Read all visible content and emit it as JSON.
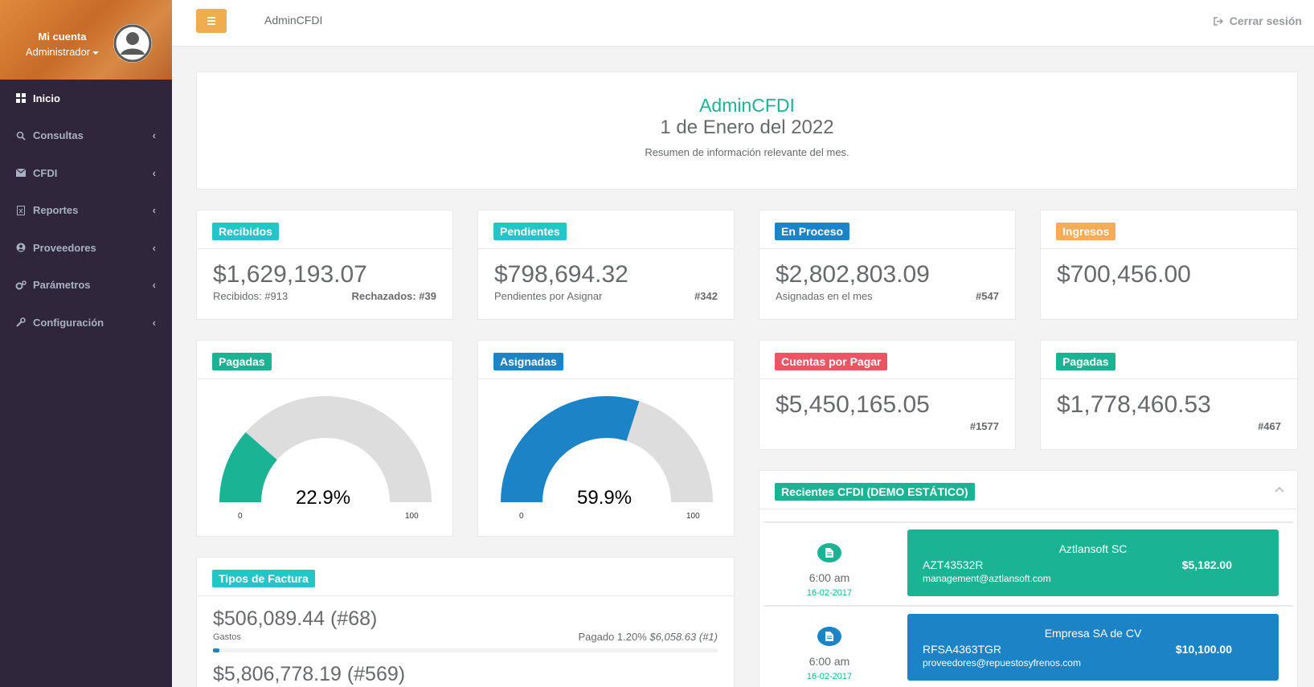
{
  "sidebar": {
    "account_name": "Mi cuenta",
    "account_role": "Administrador",
    "items": [
      {
        "label": "Inicio",
        "icon": "dashboard-icon"
      },
      {
        "label": "Consultas",
        "icon": "search-icon"
      },
      {
        "label": "CFDI",
        "icon": "envelope-icon"
      },
      {
        "label": "Reportes",
        "icon": "file-excel-icon"
      },
      {
        "label": "Proveedores",
        "icon": "user-circle-icon"
      },
      {
        "label": "Parámetros",
        "icon": "cogs-icon"
      },
      {
        "label": "Configuración",
        "icon": "wrench-icon"
      }
    ]
  },
  "topbar": {
    "brand": "AdminCFDI",
    "logout": "Cerrar sesión"
  },
  "header": {
    "title": "AdminCFDI",
    "date": "1 de Enero del 2022",
    "description": "Resumen de información relevante del mes."
  },
  "cards": {
    "recibidos": {
      "badge": "Recibidos",
      "amount": "$1,629,193.07",
      "left": "Recibidos: #913",
      "right": "Rechazados: #39"
    },
    "pendientes": {
      "badge": "Pendientes",
      "amount": "$798,694.32",
      "left": "Pendientes por Asignar",
      "right": "#342"
    },
    "en_proceso": {
      "badge": "En Proceso",
      "amount": "$2,802,803.09",
      "left": "Asignadas en el mes",
      "right": "#547"
    },
    "ingresos": {
      "badge": "Ingresos",
      "amount": "$700,456.00"
    },
    "cuentas_pagar": {
      "badge": "Cuentas por Pagar",
      "amount": "$5,450,165.05",
      "right": "#1577"
    },
    "pagadas_amount": {
      "badge": "Pagadas",
      "amount": "$1,778,460.53",
      "right": "#467"
    }
  },
  "gauges": {
    "pagadas": {
      "badge": "Pagadas",
      "percent_label": "22.9%",
      "value": 22.9,
      "min": "0",
      "max": "100",
      "color": "#1ab394"
    },
    "asignadas": {
      "badge": "Asignadas",
      "percent_label": "59.9%",
      "value": 59.9,
      "min": "0",
      "max": "100",
      "color": "#1c84c6"
    }
  },
  "tipos": {
    "badge": "Tipos de Factura",
    "rows": [
      {
        "amount": "$506,089.44 (#68)",
        "label": "Gastos",
        "paid_label": "Pagado 1.20%",
        "paid_value": "$6,058.63 (#1)",
        "progress": 1.2
      },
      {
        "amount": "$5,806,778.19 (#569)"
      }
    ]
  },
  "recientes": {
    "badge": "Recientes CFDI (DEMO ESTÁTICO)",
    "items": [
      {
        "time": "6:00 am",
        "date": "16-02-2017",
        "company": "Aztlansoft SC",
        "rfc": "AZT43532R",
        "amount": "$5,182.00",
        "email": "management@aztlansoft.com",
        "color": "#1ab394"
      },
      {
        "time": "6:00 am",
        "date": "16-02-2017",
        "company": "Empresa SA de CV",
        "rfc": "RFSA4363TGR",
        "amount": "$10,100.00",
        "email": "proveedores@repuestosyfrenos.com",
        "color": "#1c84c6"
      }
    ]
  }
}
